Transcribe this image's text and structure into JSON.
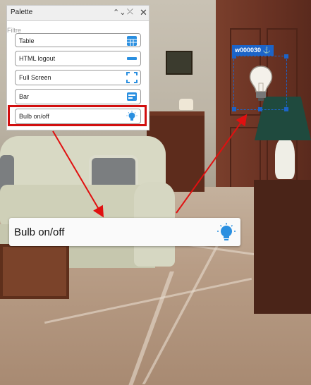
{
  "palette": {
    "title": "Palette",
    "filter_label": "Filtre",
    "items": [
      {
        "label": "Table",
        "icon": "table-icon"
      },
      {
        "label": "HTML logout",
        "icon": "logout-bar-icon"
      },
      {
        "label": "Full Screen",
        "icon": "fullscreen-icon"
      },
      {
        "label": "Bar",
        "icon": "bar-icon"
      },
      {
        "label": "Bulb on/off",
        "icon": "bulb-icon",
        "selected": true
      }
    ]
  },
  "widget": {
    "id": "w000030",
    "anchor_icon": "anchor-icon"
  },
  "preview": {
    "label": "Bulb on/off",
    "icon": "bulb-icon"
  },
  "colors": {
    "accent": "#1c64c8",
    "highlight": "#d10f0f",
    "icon_blue": "#2a8fe0"
  }
}
